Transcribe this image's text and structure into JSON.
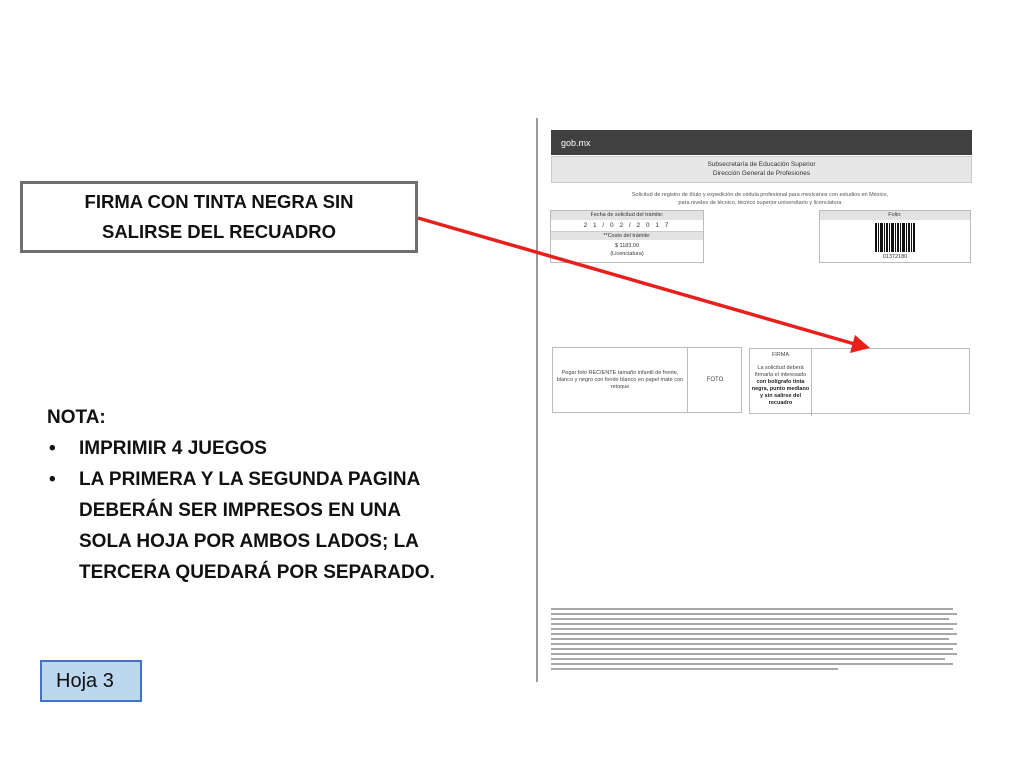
{
  "callout": {
    "line1": "FIRMA CON TINTA NEGRA SIN",
    "line2": "SALIRSE DEL RECUADRO"
  },
  "note": {
    "heading": "NOTA:",
    "items": [
      "IMPRIMIR 4 JUEGOS",
      "LA PRIMERA Y LA SEGUNDA PAGINA DEBERÁN SER IMPRESOS EN UNA SOLA HOJA POR AMBOS LADOS; LA TERCERA QUEDARÁ POR SEPARADO."
    ],
    "bullet": "•"
  },
  "sheet_label": "Hoja 3",
  "colors": {
    "arrow": "#e8201c",
    "callout_border": "#6f6f6f",
    "sheet_fill": "#bdd7ee",
    "sheet_border": "#4472c4",
    "gob_bar": "#404040"
  },
  "document": {
    "brand": "gob.mx",
    "subsecretaria": "Subsecretaría de Educación Superior",
    "direccion": "Dirección General de Profesiones",
    "description_1": "Solicitud de registro de título y expedición de cédula profesional para mexicanos con estudios en México,",
    "description_2": "para niveles de técnico, técnico superior universitario y licenciatura",
    "fecha_label": "Fecha de solicitud del trámite:",
    "fecha_value": "2 1 / 0 2 / 2 0 1 7",
    "costo_label": "**Costo del trámite:",
    "costo_value": "$ 1183.00",
    "costo_nivel": "(Licenciatura)",
    "folio_label": "Folio:",
    "folio_number": "01372180",
    "photo_instructions": "Pegar foto RECIENTE tamaño infantil de frente, blanco y negro con fondo blanco en papel mate con retoque",
    "photo_label": "FOTO",
    "firma_label": "FIRMA",
    "firma_text_1": "La solicitud deberá firmarla el interesado",
    "firma_text_2": "con bolígrafo tinta negra, punto mediano y sin salirse del recuadro"
  }
}
